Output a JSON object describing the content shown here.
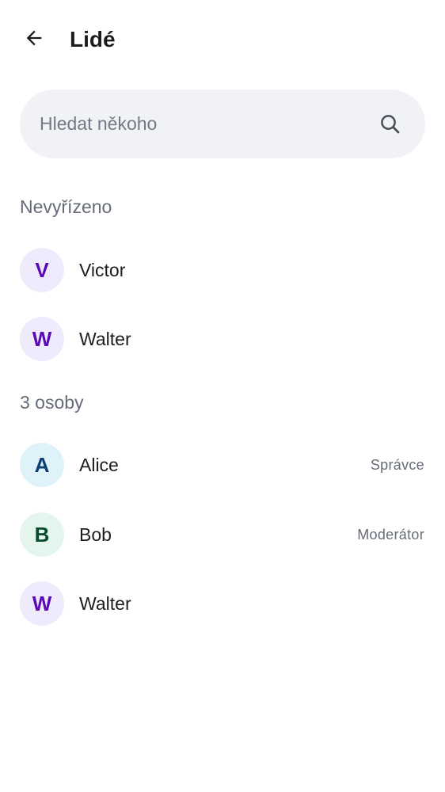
{
  "header": {
    "title": "Lidé",
    "back_icon": "arrow-left-icon"
  },
  "search": {
    "placeholder": "Hledat někoho",
    "value": "",
    "icon": "search-icon"
  },
  "pending": {
    "header": "Nevyřízeno",
    "members": [
      {
        "initial": "V",
        "name": "Victor",
        "avatar_bg": "#efebfc",
        "avatar_fg": "#5a0bb4"
      },
      {
        "initial": "W",
        "name": "Walter",
        "avatar_bg": "#efebfc",
        "avatar_fg": "#5a0bb4"
      }
    ]
  },
  "joined": {
    "header": "3 osoby",
    "members": [
      {
        "initial": "A",
        "name": "Alice",
        "role": "Správce",
        "avatar_bg": "#e0f2f9",
        "avatar_fg": "#0d3f72"
      },
      {
        "initial": "B",
        "name": "Bob",
        "role": "Moderátor",
        "avatar_bg": "#e3f5ec",
        "avatar_fg": "#0a4a2c"
      },
      {
        "initial": "W",
        "name": "Walter",
        "role": "",
        "avatar_bg": "#efebfc",
        "avatar_fg": "#5a0bb4"
      }
    ]
  }
}
